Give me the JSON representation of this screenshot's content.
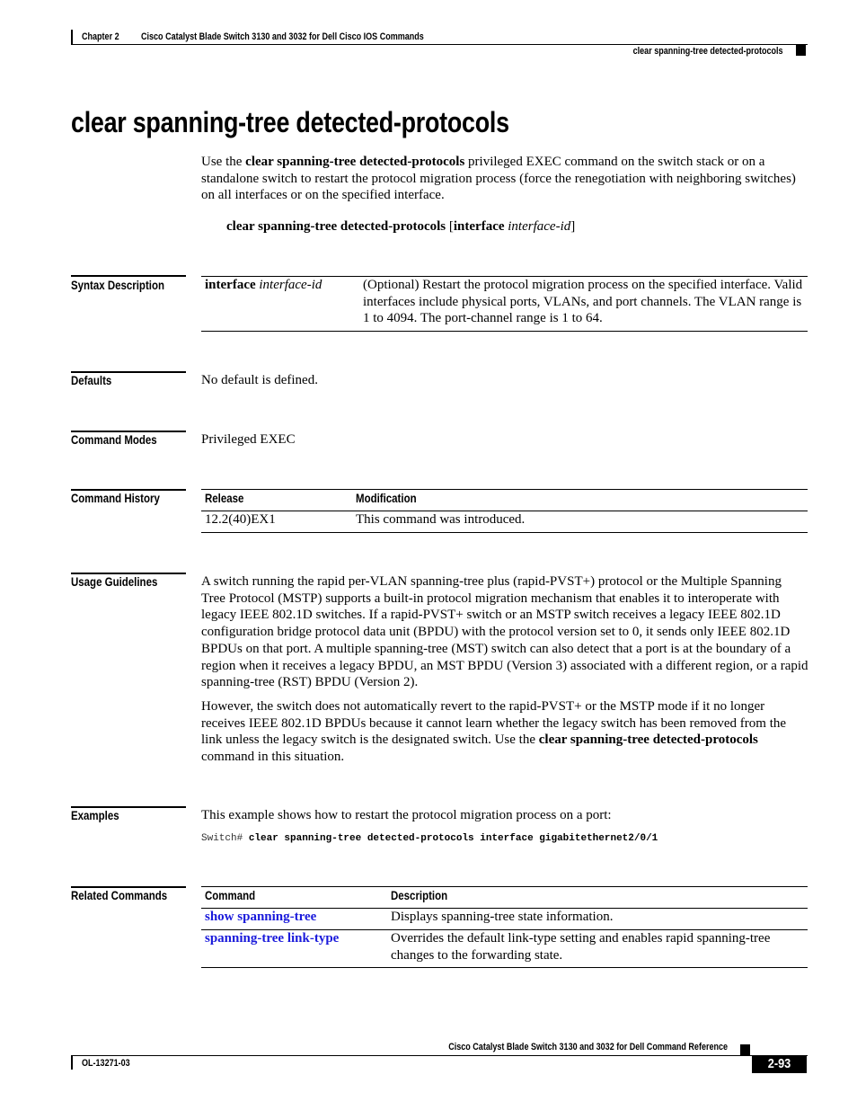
{
  "header": {
    "chapter": "Chapter 2",
    "book_section": "Cisco Catalyst Blade Switch 3130 and 3032 for Dell Cisco IOS Commands",
    "running_title": "clear spanning-tree detected-protocols"
  },
  "page_title": "clear spanning-tree detected-protocols",
  "intro": {
    "prefix": "Use the ",
    "bold": "clear spanning-tree detected-protocols",
    "suffix": " privileged EXEC command on the switch stack or on a standalone switch to restart the protocol migration process (force the renegotiation with neighboring switches) on all interfaces or on the specified interface."
  },
  "syntax": {
    "command": "clear spanning-tree detected-protocols",
    "open_bracket": " [",
    "keyword": "interface",
    "argument": "interface-id",
    "close_bracket": "]"
  },
  "sections": {
    "syntax_description": {
      "label": "Syntax Description",
      "rows": [
        {
          "keyword": "interface",
          "argument": "interface-id",
          "description": "(Optional) Restart the protocol migration process on the specified interface. Valid interfaces include physical ports, VLANs, and port channels. The VLAN range is 1 to 4094. The port-channel range is 1 to 64."
        }
      ]
    },
    "defaults": {
      "label": "Defaults",
      "text": "No default is defined."
    },
    "command_modes": {
      "label": "Command Modes",
      "text": "Privileged EXEC"
    },
    "command_history": {
      "label": "Command History",
      "columns": [
        "Release",
        "Modification"
      ],
      "rows": [
        {
          "release": "12.2(40)EX1",
          "modification": "This command was introduced."
        }
      ]
    },
    "usage_guidelines": {
      "label": "Usage Guidelines",
      "paragraph1": "A switch running the rapid per-VLAN spanning-tree plus (rapid-PVST+) protocol or the Multiple Spanning Tree Protocol (MSTP) supports a built-in protocol migration mechanism that enables it to interoperate with legacy IEEE 802.1D switches. If a rapid-PVST+ switch or an MSTP switch receives a legacy IEEE 802.1D configuration bridge protocol data unit (BPDU) with the protocol version set to 0, it sends only IEEE 802.1D BPDUs on that port. A multiple spanning-tree (MST) switch can also detect that a port is at the boundary of a region when it receives a legacy BPDU, an MST BPDU (Version 3) associated with a different region, or a rapid spanning-tree (RST) BPDU (Version 2).",
      "paragraph2_prefix": "However, the switch does not automatically revert to the rapid-PVST+ or the MSTP mode if it no longer receives IEEE 802.1D BPDUs because it cannot learn whether the legacy switch has been removed from the link unless the legacy switch is the designated switch. Use the ",
      "paragraph2_bold": "clear spanning-tree detected-protocols",
      "paragraph2_suffix": " command in this situation."
    },
    "examples": {
      "label": "Examples",
      "text": "This example shows how to restart the protocol migration process on a port:",
      "prompt": "Switch# ",
      "command": "clear spanning-tree detected-protocols interface gigabitethernet2/0/1"
    },
    "related_commands": {
      "label": "Related Commands",
      "columns": [
        "Command",
        "Description"
      ],
      "rows": [
        {
          "command": "show spanning-tree",
          "description": "Displays spanning-tree state information."
        },
        {
          "command": "spanning-tree link-type",
          "description": "Overrides the default link-type setting and enables rapid spanning-tree changes to the forwarding state."
        }
      ]
    }
  },
  "footer": {
    "book_title": "Cisco Catalyst Blade Switch 3130 and 3032 for Dell Command Reference",
    "doc_number": "OL-13271-03",
    "page_number": "2-93"
  },
  "colors": {
    "link": "#1a1adb",
    "text": "#000000"
  }
}
